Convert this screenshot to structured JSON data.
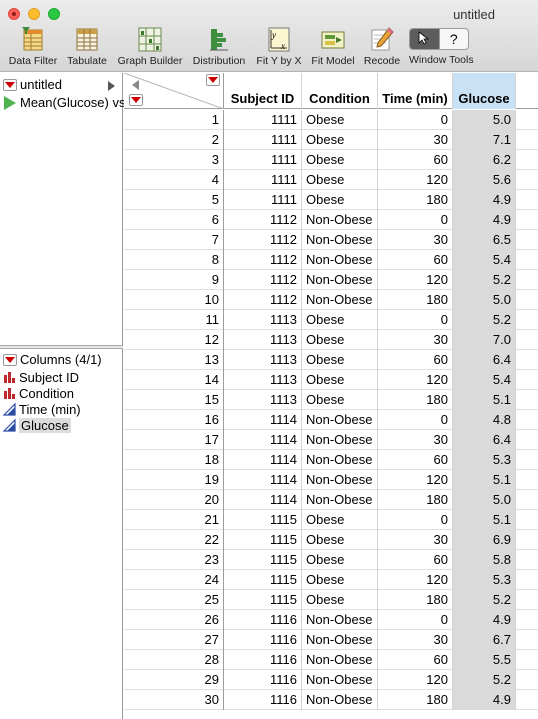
{
  "window": {
    "title": "untitled"
  },
  "toolbar": [
    {
      "label": "Data Filter",
      "icon": "data-filter-icon"
    },
    {
      "label": "Tabulate",
      "icon": "tabulate-icon"
    },
    {
      "label": "Graph Builder",
      "icon": "graph-builder-icon"
    },
    {
      "label": "Distribution",
      "icon": "distribution-icon"
    },
    {
      "label": "Fit Y by X",
      "icon": "fit-y-by-x-icon"
    },
    {
      "label": "Fit Model",
      "icon": "fit-model-icon"
    },
    {
      "label": "Recode",
      "icon": "recode-icon"
    }
  ],
  "window_tools": {
    "label": "Window Tools",
    "arrow": "➤",
    "help": "?"
  },
  "tables_panel": {
    "table_name": "untitled",
    "script_name": "Mean(Glucose) vs"
  },
  "columns_panel": {
    "header": "Columns (4/1)",
    "columns": [
      {
        "name": "Subject ID",
        "type": "nominal",
        "selected": false
      },
      {
        "name": "Condition",
        "type": "nominal",
        "selected": false
      },
      {
        "name": "Time (min)",
        "type": "continuous",
        "selected": false
      },
      {
        "name": "Glucose",
        "type": "continuous",
        "selected": true
      }
    ]
  },
  "table": {
    "headers": [
      "Subject ID",
      "Condition",
      "Time (min)",
      "Glucose"
    ],
    "selected_column": "Glucose",
    "rows": [
      [
        "1",
        "1111",
        "Obese",
        "0",
        "5.0"
      ],
      [
        "2",
        "1111",
        "Obese",
        "30",
        "7.1"
      ],
      [
        "3",
        "1111",
        "Obese",
        "60",
        "6.2"
      ],
      [
        "4",
        "1111",
        "Obese",
        "120",
        "5.6"
      ],
      [
        "5",
        "1111",
        "Obese",
        "180",
        "4.9"
      ],
      [
        "6",
        "1112",
        "Non-Obese",
        "0",
        "4.9"
      ],
      [
        "7",
        "1112",
        "Non-Obese",
        "30",
        "6.5"
      ],
      [
        "8",
        "1112",
        "Non-Obese",
        "60",
        "5.4"
      ],
      [
        "9",
        "1112",
        "Non-Obese",
        "120",
        "5.2"
      ],
      [
        "10",
        "1112",
        "Non-Obese",
        "180",
        "5.0"
      ],
      [
        "11",
        "1113",
        "Obese",
        "0",
        "5.2"
      ],
      [
        "12",
        "1113",
        "Obese",
        "30",
        "7.0"
      ],
      [
        "13",
        "1113",
        "Obese",
        "60",
        "6.4"
      ],
      [
        "14",
        "1113",
        "Obese",
        "120",
        "5.4"
      ],
      [
        "15",
        "1113",
        "Obese",
        "180",
        "5.1"
      ],
      [
        "16",
        "1114",
        "Non-Obese",
        "0",
        "4.8"
      ],
      [
        "17",
        "1114",
        "Non-Obese",
        "30",
        "6.4"
      ],
      [
        "18",
        "1114",
        "Non-Obese",
        "60",
        "5.3"
      ],
      [
        "19",
        "1114",
        "Non-Obese",
        "120",
        "5.1"
      ],
      [
        "20",
        "1114",
        "Non-Obese",
        "180",
        "5.0"
      ],
      [
        "21",
        "1115",
        "Obese",
        "0",
        "5.1"
      ],
      [
        "22",
        "1115",
        "Obese",
        "30",
        "6.9"
      ],
      [
        "23",
        "1115",
        "Obese",
        "60",
        "5.8"
      ],
      [
        "24",
        "1115",
        "Obese",
        "120",
        "5.3"
      ],
      [
        "25",
        "1115",
        "Obese",
        "180",
        "5.2"
      ],
      [
        "26",
        "1116",
        "Non-Obese",
        "0",
        "4.9"
      ],
      [
        "27",
        "1116",
        "Non-Obese",
        "30",
        "6.7"
      ],
      [
        "28",
        "1116",
        "Non-Obese",
        "60",
        "5.5"
      ],
      [
        "29",
        "1116",
        "Non-Obese",
        "120",
        "5.2"
      ],
      [
        "30",
        "1116",
        "Non-Obese",
        "180",
        "4.9"
      ]
    ]
  }
}
